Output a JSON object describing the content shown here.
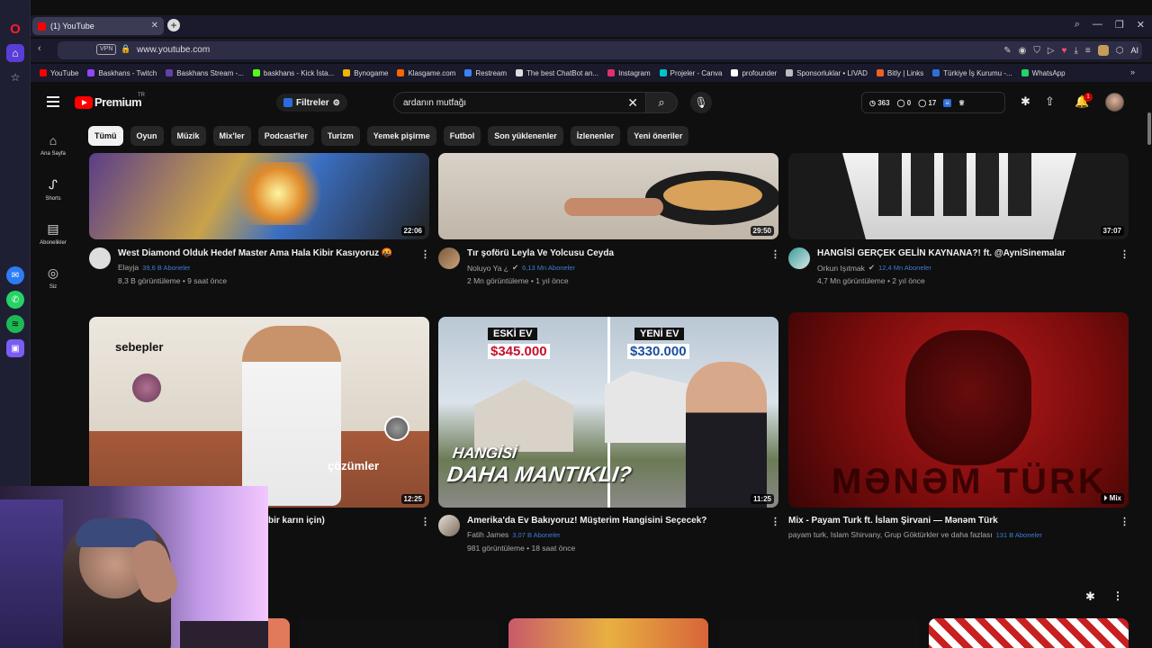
{
  "browser": {
    "tab_title": "(1) YouTube",
    "url": "www.youtube.com",
    "vpn": "VPN",
    "ai": "AI",
    "bookmarks": [
      {
        "label": "YouTube",
        "color": "#ff0000"
      },
      {
        "label": "Baskhans - Twitch",
        "color": "#9146ff"
      },
      {
        "label": "Baskhans Stream -...",
        "color": "#6441a4"
      },
      {
        "label": "baskhans - Kick İsta...",
        "color": "#53fc18"
      },
      {
        "label": "Bynogame",
        "color": "#f0b400"
      },
      {
        "label": "Klasgame.com",
        "color": "#ff6600"
      },
      {
        "label": "Restream",
        "color": "#3b82f6"
      },
      {
        "label": "The best ChatBot an...",
        "color": "#dddddd"
      },
      {
        "label": "Instagram",
        "color": "#e1306c"
      },
      {
        "label": "Projeler - Canva",
        "color": "#00c4cc"
      },
      {
        "label": "profounder",
        "color": "#ffffff"
      },
      {
        "label": "Sponsorluklar • LIVAD",
        "color": "#bbbbbb"
      },
      {
        "label": "Bitly | Links",
        "color": "#ee6123"
      },
      {
        "label": "Türkiye İş Kurumu -...",
        "color": "#2f6fd6"
      },
      {
        "label": "WhatsApp",
        "color": "#25d366"
      }
    ]
  },
  "yt": {
    "brand": "Premium",
    "region": "TR",
    "filters_label": "Filtreler",
    "search_value": "ardanın mutfağı",
    "ext_stats": {
      "a": "363",
      "b": "0",
      "c": "17"
    },
    "notif_count": "1",
    "nav": [
      {
        "label": "Ana Sayfa",
        "icon": "home-icon"
      },
      {
        "label": "Shorts",
        "icon": "shorts-icon"
      },
      {
        "label": "Abonelikler",
        "icon": "subscriptions-icon"
      },
      {
        "label": "Siz",
        "icon": "you-icon"
      }
    ],
    "chips": [
      "Tümü",
      "Oyun",
      "Müzik",
      "Mix'ler",
      "Podcast'ler",
      "Turizm",
      "Yemek pişirme",
      "Futbol",
      "Son yüklenenler",
      "İzlenenler",
      "Yeni öneriler"
    ],
    "videos": [
      {
        "title": "West Diamond Olduk Hedef Master Ama Hala Kibir Kasıyoruz 🤬",
        "channel": "Elayja",
        "subs": "39,6 B Aboneler",
        "meta": "8,3 B görüntüleme • 9 saat önce",
        "duration": "22:06"
      },
      {
        "title": "Tır şoförü Leyla Ve Yolcusu Ceyda",
        "channel": "Noluyo Ya ¿",
        "subs": "6,13 Mn Aboneler",
        "meta": "2 Mn görüntüleme • 1 yıl önce",
        "duration": "29:50"
      },
      {
        "title": "HANGİSİ GERÇEK GELİN KAYNANA?! ft. @AyniSinemalar",
        "channel": "Orkun Işıtmak",
        "subs": "12,4 Mn Aboneler",
        "meta": "4,7 Mn görüntüleme • 2 yıl önce",
        "duration": "37:07"
      },
      {
        "title": "bir karın için)",
        "channel": "",
        "subs": "",
        "meta": "",
        "duration": "12:25",
        "overlay_left": "sebepler",
        "overlay_right": "çözümler"
      },
      {
        "title": "Amerika'da Ev Bakıyoruz! Müşterim Hangisini Seçecek?",
        "channel": "Fatih James",
        "subs": "3,07 B Aboneler",
        "meta": "981 görüntüleme • 18 saat önce",
        "duration": "11:25",
        "eski": "ESKİ EV",
        "eski_price": "$345.000",
        "yeni": "YENİ EV",
        "yeni_price": "$330.000",
        "big1": "HANGİSİ",
        "big2": "DAHA MANTIKLI?"
      },
      {
        "title": "Mix - Payam Turk ft. İslam Şirvani — Mənəm Türk",
        "channel": "payam turk, Islam Shirvany, Grup Göktürkler ve daha fazlası",
        "subs": "131 B Aboneler",
        "meta": "",
        "duration": "Mix",
        "poster_text": "MƏNƏM TÜRK"
      }
    ]
  }
}
